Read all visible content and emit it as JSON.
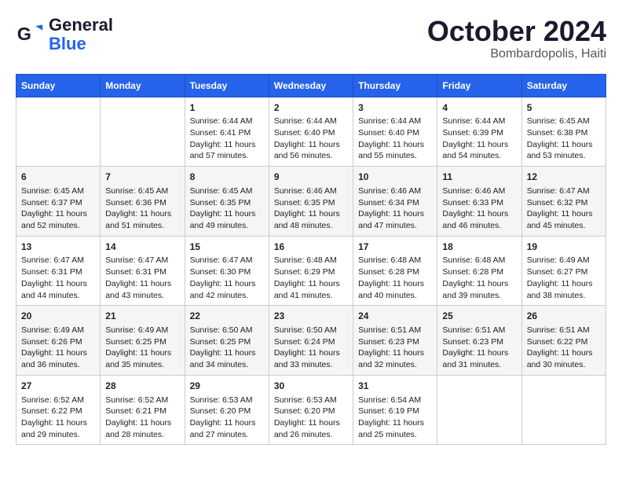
{
  "logo": {
    "text_general": "General",
    "text_blue": "Blue"
  },
  "header": {
    "month": "October 2024",
    "location": "Bombardopolis, Haiti"
  },
  "weekdays": [
    "Sunday",
    "Monday",
    "Tuesday",
    "Wednesday",
    "Thursday",
    "Friday",
    "Saturday"
  ],
  "weeks": [
    [
      {
        "day": "",
        "content": ""
      },
      {
        "day": "",
        "content": ""
      },
      {
        "day": "1",
        "content": "Sunrise: 6:44 AM\nSunset: 6:41 PM\nDaylight: 11 hours and 57 minutes."
      },
      {
        "day": "2",
        "content": "Sunrise: 6:44 AM\nSunset: 6:40 PM\nDaylight: 11 hours and 56 minutes."
      },
      {
        "day": "3",
        "content": "Sunrise: 6:44 AM\nSunset: 6:40 PM\nDaylight: 11 hours and 55 minutes."
      },
      {
        "day": "4",
        "content": "Sunrise: 6:44 AM\nSunset: 6:39 PM\nDaylight: 11 hours and 54 minutes."
      },
      {
        "day": "5",
        "content": "Sunrise: 6:45 AM\nSunset: 6:38 PM\nDaylight: 11 hours and 53 minutes."
      }
    ],
    [
      {
        "day": "6",
        "content": "Sunrise: 6:45 AM\nSunset: 6:37 PM\nDaylight: 11 hours and 52 minutes."
      },
      {
        "day": "7",
        "content": "Sunrise: 6:45 AM\nSunset: 6:36 PM\nDaylight: 11 hours and 51 minutes."
      },
      {
        "day": "8",
        "content": "Sunrise: 6:45 AM\nSunset: 6:35 PM\nDaylight: 11 hours and 49 minutes."
      },
      {
        "day": "9",
        "content": "Sunrise: 6:46 AM\nSunset: 6:35 PM\nDaylight: 11 hours and 48 minutes."
      },
      {
        "day": "10",
        "content": "Sunrise: 6:46 AM\nSunset: 6:34 PM\nDaylight: 11 hours and 47 minutes."
      },
      {
        "day": "11",
        "content": "Sunrise: 6:46 AM\nSunset: 6:33 PM\nDaylight: 11 hours and 46 minutes."
      },
      {
        "day": "12",
        "content": "Sunrise: 6:47 AM\nSunset: 6:32 PM\nDaylight: 11 hours and 45 minutes."
      }
    ],
    [
      {
        "day": "13",
        "content": "Sunrise: 6:47 AM\nSunset: 6:31 PM\nDaylight: 11 hours and 44 minutes."
      },
      {
        "day": "14",
        "content": "Sunrise: 6:47 AM\nSunset: 6:31 PM\nDaylight: 11 hours and 43 minutes."
      },
      {
        "day": "15",
        "content": "Sunrise: 6:47 AM\nSunset: 6:30 PM\nDaylight: 11 hours and 42 minutes."
      },
      {
        "day": "16",
        "content": "Sunrise: 6:48 AM\nSunset: 6:29 PM\nDaylight: 11 hours and 41 minutes."
      },
      {
        "day": "17",
        "content": "Sunrise: 6:48 AM\nSunset: 6:28 PM\nDaylight: 11 hours and 40 minutes."
      },
      {
        "day": "18",
        "content": "Sunrise: 6:48 AM\nSunset: 6:28 PM\nDaylight: 11 hours and 39 minutes."
      },
      {
        "day": "19",
        "content": "Sunrise: 6:49 AM\nSunset: 6:27 PM\nDaylight: 11 hours and 38 minutes."
      }
    ],
    [
      {
        "day": "20",
        "content": "Sunrise: 6:49 AM\nSunset: 6:26 PM\nDaylight: 11 hours and 36 minutes."
      },
      {
        "day": "21",
        "content": "Sunrise: 6:49 AM\nSunset: 6:25 PM\nDaylight: 11 hours and 35 minutes."
      },
      {
        "day": "22",
        "content": "Sunrise: 6:50 AM\nSunset: 6:25 PM\nDaylight: 11 hours and 34 minutes."
      },
      {
        "day": "23",
        "content": "Sunrise: 6:50 AM\nSunset: 6:24 PM\nDaylight: 11 hours and 33 minutes."
      },
      {
        "day": "24",
        "content": "Sunrise: 6:51 AM\nSunset: 6:23 PM\nDaylight: 11 hours and 32 minutes."
      },
      {
        "day": "25",
        "content": "Sunrise: 6:51 AM\nSunset: 6:23 PM\nDaylight: 11 hours and 31 minutes."
      },
      {
        "day": "26",
        "content": "Sunrise: 6:51 AM\nSunset: 6:22 PM\nDaylight: 11 hours and 30 minutes."
      }
    ],
    [
      {
        "day": "27",
        "content": "Sunrise: 6:52 AM\nSunset: 6:22 PM\nDaylight: 11 hours and 29 minutes."
      },
      {
        "day": "28",
        "content": "Sunrise: 6:52 AM\nSunset: 6:21 PM\nDaylight: 11 hours and 28 minutes."
      },
      {
        "day": "29",
        "content": "Sunrise: 6:53 AM\nSunset: 6:20 PM\nDaylight: 11 hours and 27 minutes."
      },
      {
        "day": "30",
        "content": "Sunrise: 6:53 AM\nSunset: 6:20 PM\nDaylight: 11 hours and 26 minutes."
      },
      {
        "day": "31",
        "content": "Sunrise: 6:54 AM\nSunset: 6:19 PM\nDaylight: 11 hours and 25 minutes."
      },
      {
        "day": "",
        "content": ""
      },
      {
        "day": "",
        "content": ""
      }
    ]
  ]
}
